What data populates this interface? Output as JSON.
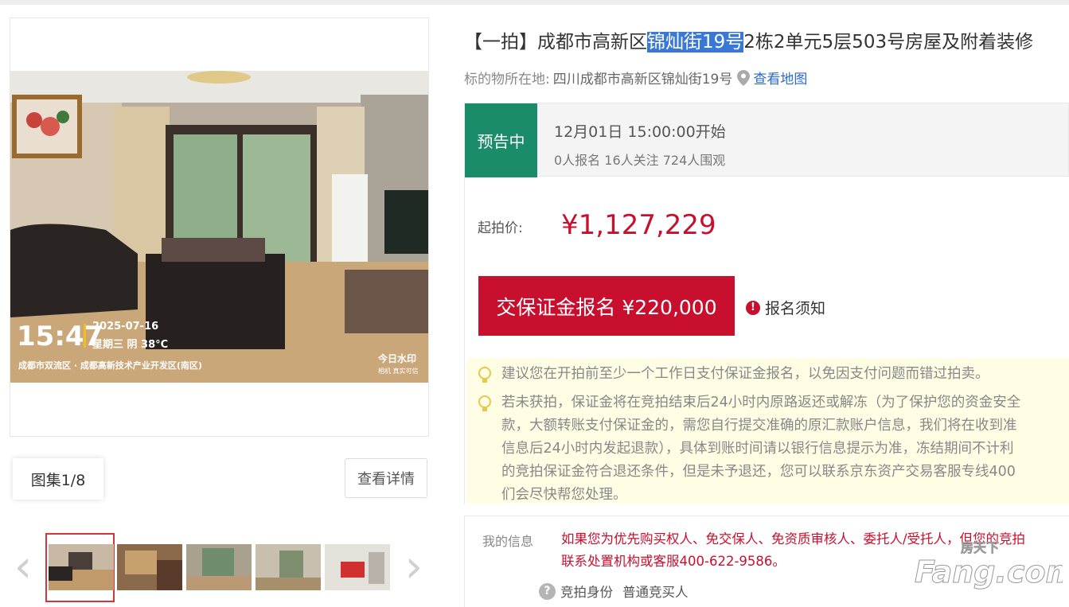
{
  "gallery": {
    "counter": "图集1/8",
    "detail_button": "查看详情",
    "photo": {
      "time": "15:47",
      "date": "2025-07-16",
      "weekday_weather": "星期三 阴 38°C",
      "location_stamp": "成都市双流区 · 成都高新技术产业开发区(南区)",
      "watermark_brand": "今日水印",
      "watermark_sub": "相机 真实可信"
    },
    "prev_icon": "chevron-left-icon",
    "next_icon": "chevron-right-icon"
  },
  "listing": {
    "title_prefix": "【一拍】成都市高新区",
    "title_highlight": "锦灿街19号",
    "title_suffix": "2栋2单元5层503号房屋及附着装修",
    "location_label": "标的物所在地:",
    "location_address": "四川成都市高新区锦灿街19号",
    "map_link": "查看地图"
  },
  "status": {
    "badge": "预告中",
    "start_time": "12月01日 15:00:00开始",
    "stats": "0人报名  16人关注  724人围观",
    "badge_color": "#1b8c6a"
  },
  "pricing": {
    "start_label": "起拍价:",
    "start_price": "¥1,127,229",
    "deposit_button": "交保证金报名 ¥220,000",
    "notice_link": "报名须知",
    "accent_color": "#c8102e"
  },
  "tips": {
    "tip1": "建议您在开拍前至少一个工作日支付保证金报名，以免因支付问题而错过拍卖。",
    "tip2_lines": [
      "若未获拍，保证金将在竞拍结束后24小时内原路返还或解冻（为了保护您的资金安全",
      "款，大额转账支付保证金的，需您自行提交准确的原汇款账户信息，我们将在收到准",
      "信息后24小时内发起退款），具体到账时间请以银行信息提示为准，冻结期间不计利",
      "的竞拍保证金符合退还条件，但是未予退还，您可以联系京东资产交易客服专线400",
      "们会尽快帮您处理。"
    ]
  },
  "my_info": {
    "label": "我的信息",
    "line1": "如果您为优先购买权人、免交保人、免资质审核人、委托人/受托人，但您的竞拍",
    "line2": "联系处置机构或客服400-622-9586。",
    "identity_label": "竞拍身份",
    "identity_value": "普通竞买人"
  },
  "site_watermark": {
    "top": "房天下",
    "main": "Fang.com"
  }
}
